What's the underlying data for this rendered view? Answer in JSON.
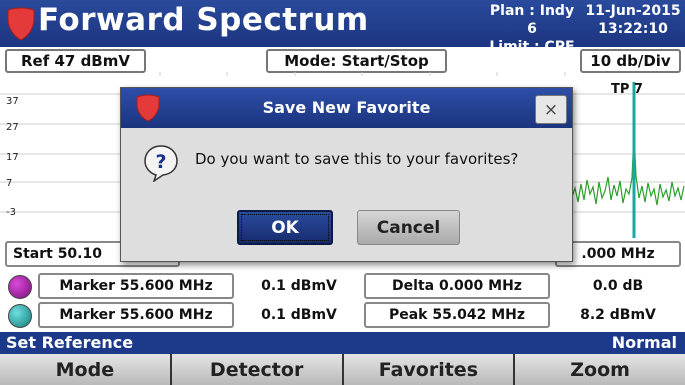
{
  "header": {
    "title": "Forward Spectrum",
    "plan": "Plan : Indy 6",
    "limit": "Limit : CPE",
    "date": "11-Jun-2015",
    "time": "13:22:10"
  },
  "settings": {
    "ref": "Ref 47 dBmV",
    "mode": "Mode: Start/Stop",
    "scale": "10 db/Div"
  },
  "graph": {
    "y_labels": [
      "37",
      "27",
      "17",
      "7",
      "-3"
    ],
    "marker_label": "TP 7",
    "trace_color": "#2aa02a",
    "marker_line_color": "#1aa6a6"
  },
  "freq": {
    "start": "Start 50.10",
    "stop": ".000 MHz"
  },
  "markers": [
    {
      "dot_color": "#8a1a8a",
      "freq": "Marker 55.600 MHz",
      "level": "0.1 dBmV",
      "info": "Delta 0.000 MHz",
      "info_value": "0.0 dB"
    },
    {
      "dot_color": "#1a9a9a",
      "freq": "Marker 55.600 MHz",
      "level": "0.1 dBmV",
      "info": "Peak 55.042 MHz",
      "info_value": "8.2 dBmV"
    }
  ],
  "status": {
    "left": "Set Reference",
    "right": "Normal"
  },
  "softkeys": [
    "Mode",
    "Detector",
    "Favorites",
    "Zoom"
  ],
  "dialog": {
    "title": "Save New Favorite",
    "close": "×",
    "message": "Do you want to save this to your favorites?",
    "ok": "OK",
    "cancel": "Cancel"
  },
  "colors": {
    "header": "#1c3580",
    "logo": "#e53a3a"
  }
}
